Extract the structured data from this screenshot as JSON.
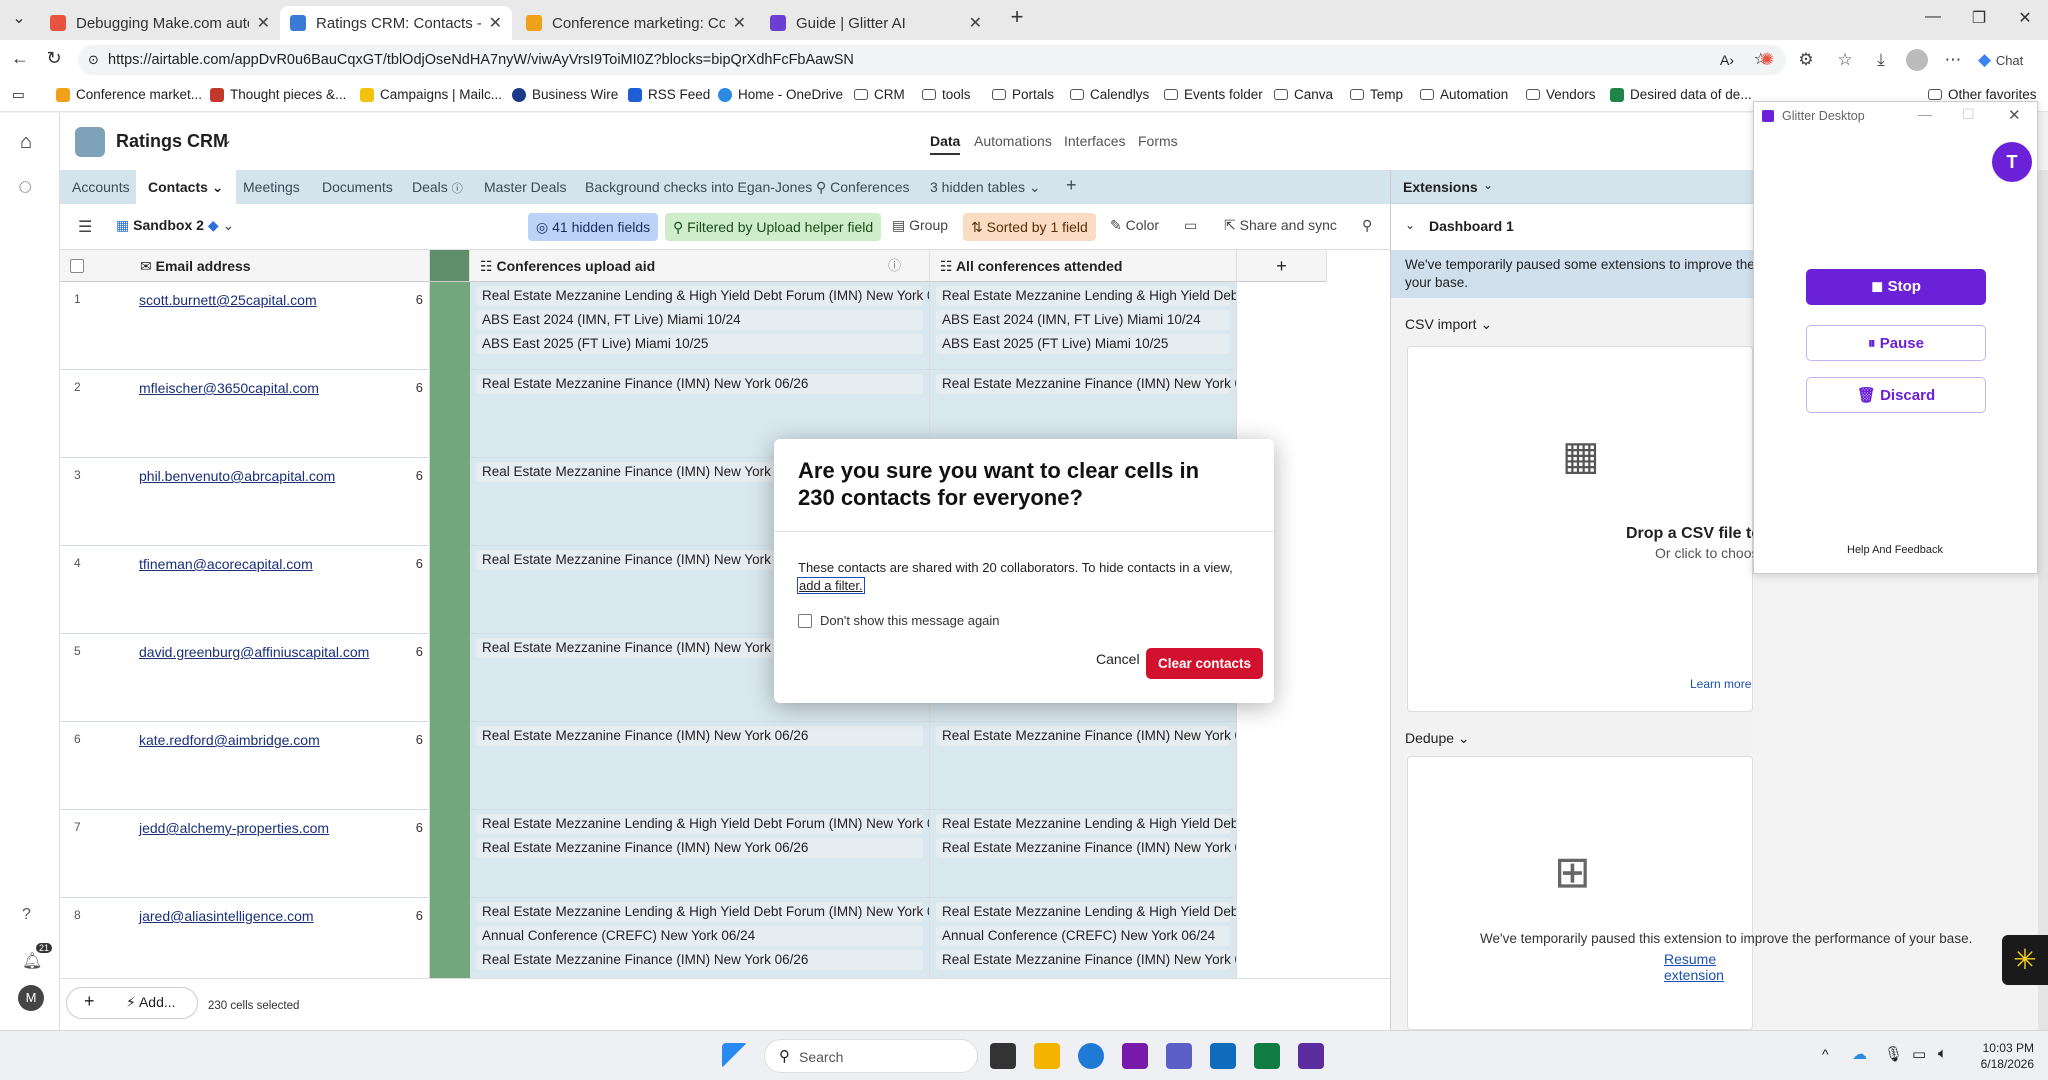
{
  "browser": {
    "tabs": [
      {
        "title": "Debugging Make.com automation",
        "color": "#e8533f"
      },
      {
        "title": "Ratings CRM: Contacts - Airtable",
        "color": "#3a7bd5"
      },
      {
        "title": "Conference marketing: Conference",
        "color": "#f0a11a"
      },
      {
        "title": "Guide | Glitter AI",
        "color": "#6b3fd1"
      }
    ],
    "url": "https://airtable.com/appDvR0u6BauCqxGT/tblOdjOseNdHA7nyW/viwAyVrsI9ToiMI0Z?blocks=bipQrXdhFcFbAawSN",
    "chat_label": "Chat",
    "bookmarks": [
      {
        "label": "Conference market...",
        "icon": "bookmark-airtable-icon"
      },
      {
        "label": "Thought pieces &...",
        "icon": "bookmark-icon"
      },
      {
        "label": "Campaigns | Mailc...",
        "icon": "bookmark-mailchimp-icon"
      },
      {
        "label": "Business Wire",
        "icon": "bookmark-icon"
      },
      {
        "label": "RSS Feed",
        "icon": "rss-icon"
      },
      {
        "label": "Home - OneDrive",
        "icon": "onedrive-icon"
      },
      {
        "label": "CRM",
        "icon": "folder-icon"
      },
      {
        "label": "tools",
        "icon": "folder-icon"
      },
      {
        "label": "Portals",
        "icon": "folder-icon"
      },
      {
        "label": "Calendlys",
        "icon": "folder-icon"
      },
      {
        "label": "Events folder",
        "icon": "folder-icon"
      },
      {
        "label": "Canva",
        "icon": "folder-icon"
      },
      {
        "label": "Temp",
        "icon": "folder-icon"
      },
      {
        "label": "Automation",
        "icon": "folder-icon"
      },
      {
        "label": "Vendors",
        "icon": "folder-icon"
      },
      {
        "label": "Desired data of de...",
        "icon": "bookmark-icon"
      }
    ],
    "other_favorites": "Other favorites"
  },
  "app": {
    "base_name": "Ratings CRM",
    "nav": [
      "Data",
      "Automations",
      "Interfaces",
      "Forms"
    ],
    "tables": [
      "Accounts",
      "Contacts",
      "Meetings",
      "Documents",
      "Deals",
      "Master Deals",
      "Background checks into Egan-Jones",
      "Conferences",
      "3 hidden tables"
    ],
    "view_name": "Sandbox 2",
    "toolbar": {
      "hidden_fields": "41 hidden fields",
      "filtered": "Filtered by Upload helper field",
      "group": "Group",
      "sorted": "Sorted by 1 field",
      "color": "Color",
      "share": "Share and sync"
    },
    "columns": [
      "Email address",
      "Conferences upload aid",
      "All conferences attended"
    ],
    "rows": [
      {
        "num": "1",
        "email": "scott.burnett@25capital.com",
        "count": "6",
        "upload": [
          "Real Estate Mezzanine Lending & High Yield Debt Forum (IMN) New York 06/2",
          "ABS East 2024 (IMN, FT Live) Miami 10/24",
          "ABS East 2025 (FT Live) Miami 10/25"
        ],
        "all": [
          "Real Estate Mezzanine Lending & High Yield Debt F",
          "ABS East 2024 (IMN, FT Live) Miami 10/24",
          "ABS East 2025 (FT Live) Miami 10/25"
        ]
      },
      {
        "num": "2",
        "email": "mfleischer@3650capital.com",
        "count": "6",
        "upload": [
          "Real Estate Mezzanine Finance (IMN) New York 06/26"
        ],
        "all": [
          "Real Estate Mezzanine Finance (IMN) New York 06/"
        ]
      },
      {
        "num": "3",
        "email": "phil.benvenuto@abrcapital.com",
        "count": "6",
        "upload": [
          "Real Estate Mezzanine Finance (IMN) New York 06/"
        ],
        "all": []
      },
      {
        "num": "4",
        "email": "tfineman@acorecapital.com",
        "count": "6",
        "upload": [
          "Real Estate Mezzanine Finance (IMN) New York 06/"
        ],
        "all": []
      },
      {
        "num": "5",
        "email": "david.greenburg@affiniuscapital.com",
        "count": "6",
        "upload": [
          "Real Estate Mezzanine Finance (IMN) New York 06/"
        ],
        "all": []
      },
      {
        "num": "6",
        "email": "kate.redford@aimbridge.com",
        "count": "6",
        "upload": [
          "Real Estate Mezzanine Finance (IMN) New York 06/26"
        ],
        "all": [
          "Real Estate Mezzanine Finance (IMN) New York 06/"
        ]
      },
      {
        "num": "7",
        "email": "jedd@alchemy-properties.com",
        "count": "6",
        "upload": [
          "Real Estate Mezzanine Lending & High Yield Debt Forum (IMN) New York 06/2",
          "Real Estate Mezzanine Finance (IMN) New York 06/26"
        ],
        "all": [
          "Real Estate Mezzanine Lending & High Yield Debt F",
          "Real Estate Mezzanine Finance (IMN) New York 06/"
        ]
      },
      {
        "num": "8",
        "email": "jared@aliasintelligence.com",
        "count": "6",
        "upload": [
          "Real Estate Mezzanine Lending & High Yield Debt Forum (IMN) New York 06/2",
          "Annual Conference (CREFC) New York 06/24",
          "Real Estate Mezzanine Finance (IMN) New York 06/26"
        ],
        "all": [
          "Real Estate Mezzanine Lending & High Yield Debt F",
          "Annual Conference (CREFC) New York 06/24",
          "Real Estate Mezzanine Finance (IMN) New York 06/"
        ]
      }
    ],
    "footer": {
      "add_label": "Add...",
      "selection": "230 cells selected"
    },
    "left_badge": "21",
    "avatar": "M"
  },
  "extensions": {
    "title": "Extensions",
    "dashboard": "Dashboard 1",
    "paused_notice": "We've temporarily paused some extensions to improve the p",
    "paused_notice2": "your base.",
    "csv_title": "CSV import",
    "csv_drop": "Drop a CSV file to",
    "csv_click": "Or click to choose",
    "learn_more": "Learn more",
    "dedupe": "Dedupe",
    "dedupe_paused": "We've temporarily paused this extension to improve the performance of your base.",
    "resume": "Resume extension"
  },
  "glitter": {
    "title": "Glitter Desktop",
    "avatar": "T",
    "stop": "Stop",
    "pause": "Pause",
    "discard": "Discard",
    "help": "Help And Feedback"
  },
  "modal": {
    "title": "Are you sure you want to clear cells in 230 contacts for everyone?",
    "body": "These contacts are shared with 20 collaborators. To hide contacts in a view,",
    "link": "add a filter.",
    "checkbox": "Don't show this message again",
    "cancel": "Cancel",
    "confirm": "Clear contacts"
  },
  "taskbar": {
    "search": "Search",
    "time": "10:03 PM",
    "date": "6/18/2026"
  },
  "colors": {
    "accent_airtable": "#d4e4ec",
    "danger": "#d1112d",
    "glitter_purple": "#6b21d8"
  }
}
